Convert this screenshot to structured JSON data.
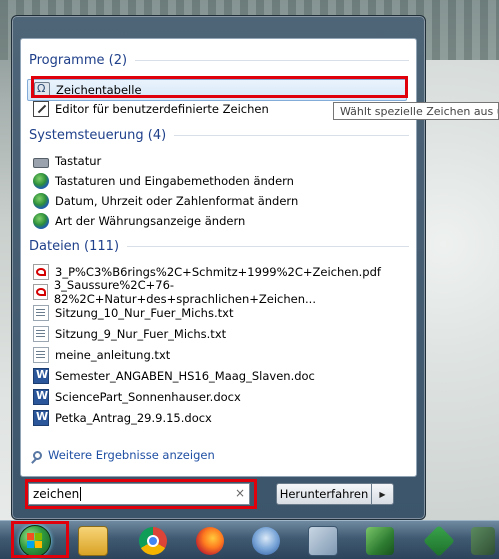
{
  "programs": {
    "header": "Programme (2)",
    "items": [
      {
        "label": "Zeichentabelle",
        "icon": "character-map-icon",
        "selected": true
      },
      {
        "label": "Editor für benutzerdefinierte Zeichen",
        "icon": "private-character-editor-icon"
      }
    ]
  },
  "control_panel": {
    "header": "Systemsteuerung (4)",
    "items": [
      {
        "label": "Tastatur",
        "icon": "keyboard-icon"
      },
      {
        "label": "Tastaturen und Eingabemethoden ändern",
        "icon": "globe-icon"
      },
      {
        "label": "Datum, Uhrzeit oder Zahlenformat ändern",
        "icon": "globe-icon"
      },
      {
        "label": "Art der Währungsanzeige ändern",
        "icon": "globe-icon"
      }
    ]
  },
  "files": {
    "header": "Dateien (111)",
    "items": [
      {
        "label": "3_P%C3%B6rings%2C+Schmitz+1999%2C+Zeichen.pdf",
        "icon": "pdf-icon"
      },
      {
        "label": "3_Saussure%2C+76-82%2C+Natur+des+sprachlichen+Zeichen...",
        "icon": "pdf-icon"
      },
      {
        "label": "Sitzung_10_Nur_Fuer_Michs.txt",
        "icon": "text-file-icon"
      },
      {
        "label": "Sitzung_9_Nur_Fuer_Michs.txt",
        "icon": "text-file-icon"
      },
      {
        "label": "meine_anleitung.txt",
        "icon": "text-file-icon"
      },
      {
        "label": "Semester_ANGABEN_HS16_Maag_Slaven.doc",
        "icon": "word-doc-icon"
      },
      {
        "label": "SciencePart_Sonnenhauser.docx",
        "icon": "word-doc-icon"
      },
      {
        "label": "Petka_Antrag_29.9.15.docx",
        "icon": "word-doc-icon"
      }
    ]
  },
  "more_results": "Weitere Ergebnisse anzeigen",
  "search": {
    "value": "zeichen",
    "clear_symbol": "×"
  },
  "shutdown": {
    "label": "Herunterfahren",
    "arrow": "▶"
  },
  "tooltip": "Wählt spezielle Zeichen aus und",
  "colors": {
    "highlight": "#e0000b",
    "section_header": "#1e3f8a",
    "link": "#1f4fa3"
  },
  "taskbar": {
    "items": [
      "start-orb-icon",
      "windows-explorer-icon",
      "chrome-icon",
      "firefox-icon",
      "thunderbird-icon",
      "network-icon",
      "security-icon",
      "vim-icon",
      "app-icon"
    ]
  }
}
